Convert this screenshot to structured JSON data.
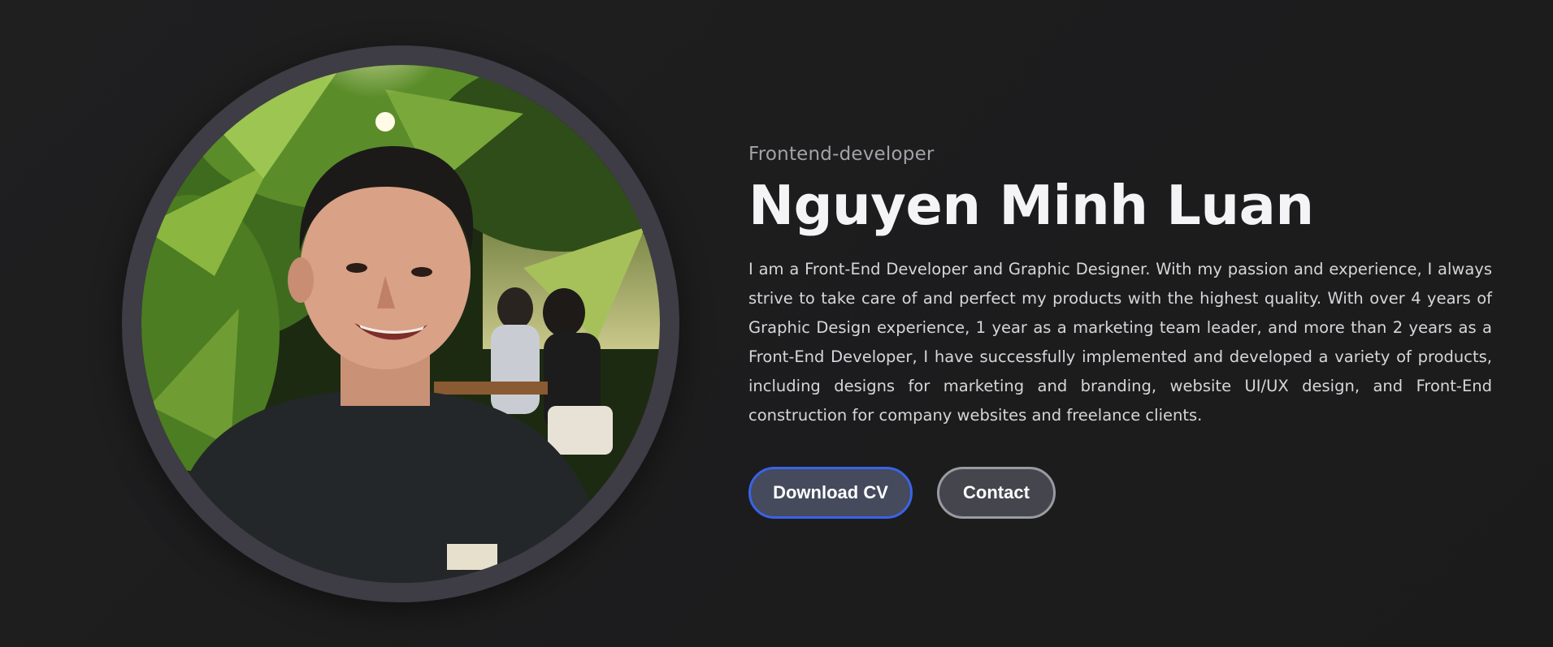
{
  "profile": {
    "role": "Frontend-developer",
    "name": "Nguyen Minh Luan",
    "bio": "I am a Front-End Developer and Graphic Designer. With my passion and experience, I always strive to take care of and perfect my products with the highest quality. With over 4 years of Graphic Design experience, 1 year as a marketing team leader, and more than 2 years as a Front-End Developer, I have successfully implemented and developed a variety of products, including designs for marketing and branding, website UI/UX design, and Front-End construction for company websites and freelance clients."
  },
  "actions": {
    "download_cv_label": "Download CV",
    "contact_label": "Contact"
  },
  "colors": {
    "background": "#1e1e1f",
    "avatar_ring": "#3e3c44",
    "primary_button_border": "#3a63e8",
    "secondary_button_border": "#9a9aa3",
    "button_fill": "#4a4a55"
  }
}
